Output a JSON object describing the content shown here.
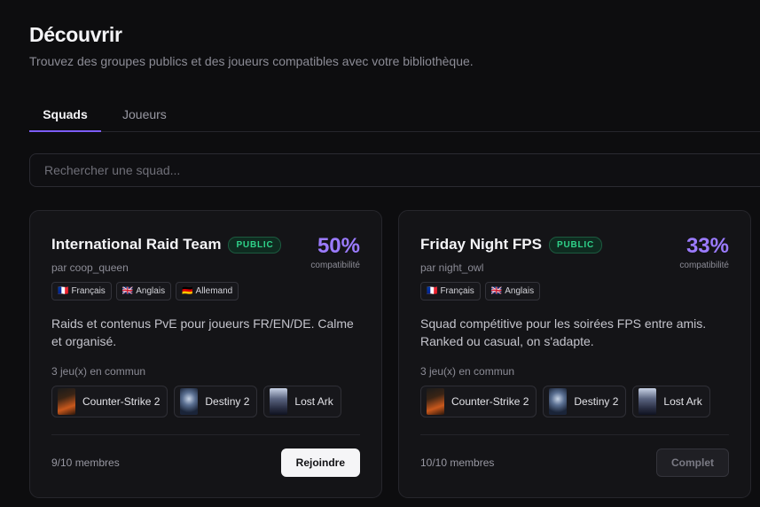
{
  "page": {
    "title": "Découvrir",
    "subtitle": "Trouvez des groupes publics et des joueurs compatibles avec votre bibliothèque."
  },
  "tabs": [
    {
      "label": "Squads",
      "active": true
    },
    {
      "label": "Joueurs",
      "active": false
    }
  ],
  "search": {
    "placeholder": "Rechercher une squad...",
    "value": ""
  },
  "colors": {
    "accent": "#7c5cf5",
    "compat": "#9b7bff",
    "public_badge": "#2fd38a"
  },
  "squads": [
    {
      "name": "International Raid Team",
      "visibility": "PUBLIC",
      "owner": "par coop_queen",
      "compat_value": "50%",
      "compat_label": "compatibilité",
      "languages": [
        {
          "flag": "🇫🇷",
          "label": "Français"
        },
        {
          "flag": "🇬🇧",
          "label": "Anglais"
        },
        {
          "flag": "🇩🇪",
          "label": "Allemand"
        }
      ],
      "description": "Raids et contenus PvE pour joueurs FR/EN/DE. Calme et organisé.",
      "common_games_label": "3 jeu(x) en commun",
      "games": [
        {
          "name": "Counter-Strike 2",
          "icon": "counter-strike-2-cover"
        },
        {
          "name": "Destiny 2",
          "icon": "destiny-2-cover"
        },
        {
          "name": "Lost Ark",
          "icon": "lost-ark-cover"
        }
      ],
      "members": "9/10 membres",
      "action_label": "Rejoindre",
      "action_enabled": true
    },
    {
      "name": "Friday Night FPS",
      "visibility": "PUBLIC",
      "owner": "par night_owl",
      "compat_value": "33%",
      "compat_label": "compatibilité",
      "languages": [
        {
          "flag": "🇫🇷",
          "label": "Français"
        },
        {
          "flag": "🇬🇧",
          "label": "Anglais"
        }
      ],
      "description": "Squad compétitive pour les soirées FPS entre amis. Ranked ou casual, on s'adapte.",
      "common_games_label": "3 jeu(x) en commun",
      "games": [
        {
          "name": "Counter-Strike 2",
          "icon": "counter-strike-2-cover"
        },
        {
          "name": "Destiny 2",
          "icon": "destiny-2-cover"
        },
        {
          "name": "Lost Ark",
          "icon": "lost-ark-cover"
        }
      ],
      "members": "10/10 membres",
      "action_label": "Complet",
      "action_enabled": false
    }
  ]
}
